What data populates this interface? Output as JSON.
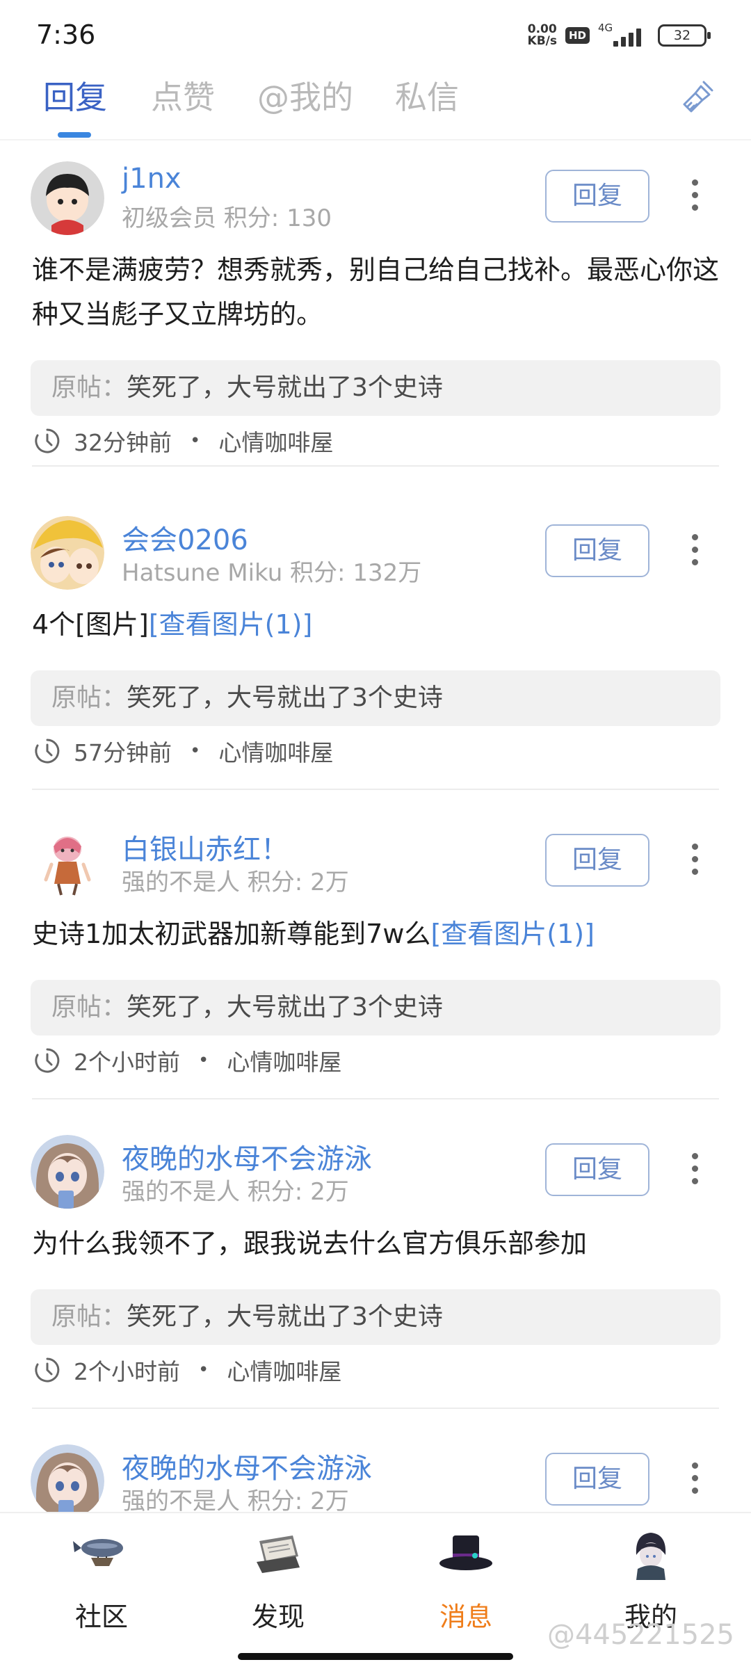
{
  "status_bar": {
    "time": "7:36",
    "net_speed_value": "0.00",
    "net_speed_unit": "KB/s",
    "hd": "HD",
    "network": "4G",
    "battery": "32"
  },
  "tabs": [
    {
      "label": "回复",
      "active": true
    },
    {
      "label": "点赞",
      "active": false
    },
    {
      "label": "@我的",
      "active": false
    },
    {
      "label": "私信",
      "active": false
    }
  ],
  "header_icons": {
    "clear": "broom-icon"
  },
  "original_label": "原帖：",
  "reply_label": "回复",
  "posts": [
    {
      "name": "j1nx",
      "meta": "初级会员  积分: 130",
      "content": "谁不是满疲劳？想秀就秀，别自己给自己找补。最恶心你这种又当彪子又立牌坊的。",
      "link": "",
      "original": "笑死了，大号就出了3个史诗",
      "time": "32分钟前",
      "forum": "心情咖啡屋"
    },
    {
      "name": "会会0206",
      "meta": "Hatsune Miku  积分: 132万",
      "content": "4个[图片]",
      "link": "[查看图片(1)]",
      "original": "笑死了，大号就出了3个史诗",
      "time": "57分钟前",
      "forum": "心情咖啡屋"
    },
    {
      "name": "白银山赤红！",
      "meta": "强的不是人  积分: 2万",
      "content": "史诗1加太初武器加新尊能到7w么",
      "link": "[查看图片(1)]",
      "original": "笑死了，大号就出了3个史诗",
      "time": "2个小时前",
      "forum": "心情咖啡屋"
    },
    {
      "name": "夜晚的水母不会游泳",
      "meta": "强的不是人  积分: 2万",
      "content": "为什么我领不了，跟我说去什么官方俱乐部参加",
      "link": "",
      "original": "笑死了，大号就出了3个史诗",
      "time": "2个小时前",
      "forum": "心情咖啡屋"
    },
    {
      "name": "夜晚的水母不会游泳",
      "meta": "强的不是人  积分: 2万"
    }
  ],
  "bottom_nav": [
    {
      "label": "社区",
      "active": false
    },
    {
      "label": "发现",
      "active": false
    },
    {
      "label": "消息",
      "active": true
    },
    {
      "label": "我的",
      "active": false
    }
  ],
  "watermark": "@445221525",
  "colors": {
    "accent_blue": "#4a84d8",
    "tab_active": "#3a62c4",
    "nav_active": "#ef7d1a"
  }
}
